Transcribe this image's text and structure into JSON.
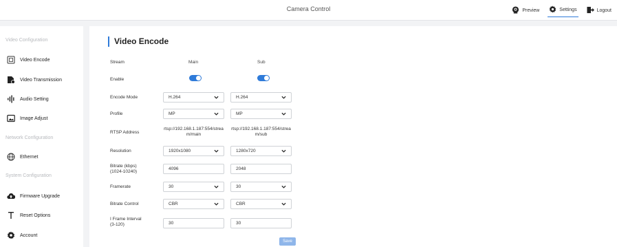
{
  "app_title": "Camera Control",
  "nav": {
    "preview": "Preview",
    "settings": "Settings",
    "logout": "Logout"
  },
  "sidebar": {
    "video_section": "Video Configuration",
    "network_section": "Network Configuration",
    "system_section": "System Configuration",
    "items": {
      "video_encode": "Video Encode",
      "video_transmission": "Video Transmission",
      "audio_setting": "Audio Setting",
      "image_adjust": "Image Adjust",
      "ethernet": "Ethernet",
      "firmware_upgrade": "Firmware Upgrade",
      "reset_options": "Reset Options",
      "account": "Account"
    }
  },
  "main": {
    "title": "Video Encode",
    "labels": {
      "stream": "Stream",
      "enable": "Enable",
      "encode_mode": "Encode Mode",
      "profile": "Profile",
      "rtsp": "RTSP Address",
      "resolution": "Resolution",
      "bitrate": "Bitrate (kbps)\n(1024-10240)",
      "framerate": "Framerate",
      "bitrate_control": "Bitrate Control",
      "iframe": "I Frame Interval\n(3-120)"
    },
    "main_stream": {
      "head": "Main",
      "enabled": true,
      "encode_mode": "H.264",
      "profile": "MP",
      "rtsp": "rtsp://192.168.1.187:554/stream/main",
      "resolution": "1920x1080",
      "bitrate": "4096",
      "framerate": "30",
      "bitrate_control": "CBR",
      "iframe": "30"
    },
    "sub_stream": {
      "head": "Sub",
      "enabled": true,
      "encode_mode": "H.264",
      "profile": "MP",
      "rtsp": "rtsp://192.168.1.187:554/stream/sub",
      "resolution": "1280x720",
      "bitrate": "2048",
      "framerate": "30",
      "bitrate_control": "CBR",
      "iframe": "30"
    },
    "save_label": "Save"
  },
  "colors": {
    "accent": "#2f7bd9",
    "save_button": "#8fb6ea"
  }
}
